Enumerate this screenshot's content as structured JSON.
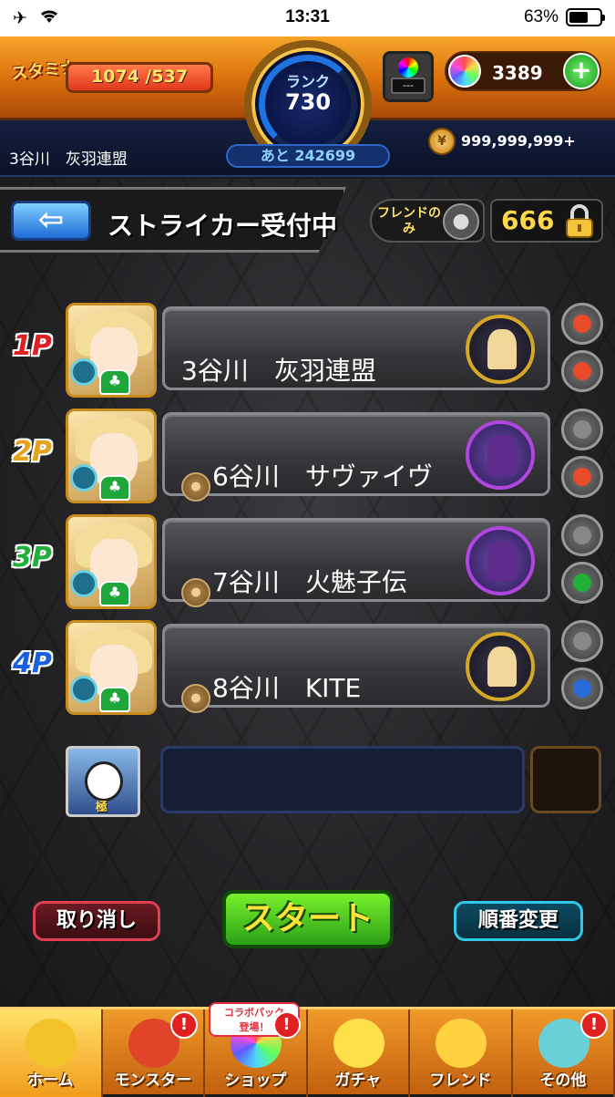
{
  "status_bar": {
    "time": "13:31",
    "battery": "63%",
    "battery_level": 0.63
  },
  "header": {
    "stamina_label": "スタミナ",
    "stamina_text": "1074 /537",
    "rank_label": "ランク",
    "rank_value": "730",
    "rank_next": "あと 242699",
    "mailbox_screen": "---",
    "orb_count": "3389",
    "player_name": "3谷川　灰羽連盟",
    "coins": "999,999,999+"
  },
  "title_bar": {
    "title": "ストライカー受付中",
    "friend_only_label": "フレンドのみ",
    "room_number": "666"
  },
  "players": [
    {
      "slot": "1P",
      "color": "#e02020",
      "name": "3谷川　灰羽連盟",
      "guild": false,
      "avatar": "gold"
    },
    {
      "slot": "2P",
      "color": "#e8a21a",
      "name": "6谷川　サヴァイヴ",
      "guild": true,
      "avatar": "purple"
    },
    {
      "slot": "3P",
      "color": "#1fb03a",
      "name": "7谷川　火魅子伝",
      "guild": true,
      "avatar": "purple"
    },
    {
      "slot": "4P",
      "color": "#1a5fe0",
      "name": "8谷川　KITE",
      "guild": true,
      "avatar": "gold"
    }
  ],
  "helper": {
    "badge": "極"
  },
  "actions": {
    "cancel": "取り消し",
    "start": "スタート",
    "change_order": "順番変更"
  },
  "nav": {
    "items": [
      {
        "label": "ホーム",
        "icon": "home-gate-icon",
        "badge": ""
      },
      {
        "label": "モンスター",
        "icon": "dragon-icon",
        "badge": "!"
      },
      {
        "label": "ショップ",
        "icon": "orb-icon",
        "badge": "!",
        "bubble": "コラボパック\n登場！"
      },
      {
        "label": "ガチャ",
        "icon": "gacha-egg-icon",
        "badge": ""
      },
      {
        "label": "フレンド",
        "icon": "friends-icon",
        "badge": ""
      },
      {
        "label": "その他",
        "icon": "question-icon",
        "badge": "!"
      }
    ]
  },
  "colors": {
    "accent_orange": "#f09a2a",
    "start_green": "#2ba018",
    "cancel_red": "#e04052",
    "order_cyan": "#30c8e8"
  }
}
